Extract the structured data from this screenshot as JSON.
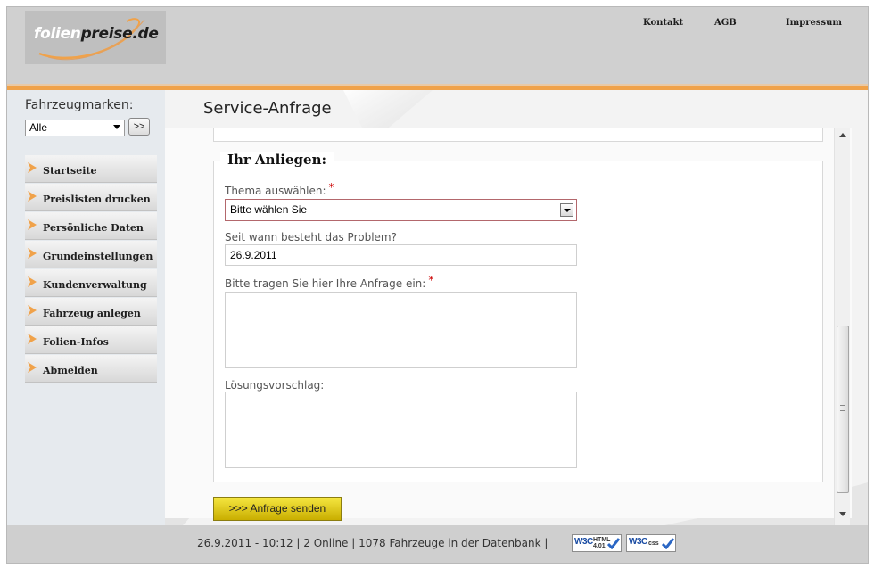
{
  "header": {
    "logo": {
      "part1": "folien",
      "part2": "preise.de"
    },
    "nav": [
      "Kontakt",
      "AGB",
      "Impressum"
    ]
  },
  "sidebar": {
    "brand_label": "Fahrzeugmarken:",
    "brand_select_value": "Alle",
    "go_button": ">>",
    "menu": [
      "Startseite",
      "Preislisten drucken",
      "Persönliche Daten",
      "Grundeinstellungen",
      "Kundenverwaltung",
      "Fahrzeug anlegen",
      "Folien-Infos",
      "Abmelden"
    ]
  },
  "main": {
    "title": "Service-Anfrage",
    "legend": "Ihr Anliegen:",
    "required_marker": "*",
    "fields": {
      "topic_label": "Thema auswählen:",
      "topic_value": "Bitte wählen Sie",
      "since_label": "Seit wann besteht das Problem?",
      "since_value": "26.9.2011",
      "request_label": "Bitte tragen Sie hier Ihre Anfrage ein:",
      "request_value": "",
      "solution_label": "Lösungsvorschlag:",
      "solution_value": ""
    },
    "submit_button": ">>> Anfrage senden"
  },
  "footer": {
    "status_text": "26.9.2011 - 10:12 | 2 Online | 1078 Fahrzeuge in der Datenbank |",
    "badges": [
      {
        "logo": "W3C",
        "kind_line1": "HTML",
        "kind_line2": "4.01"
      },
      {
        "logo": "W3C",
        "kind_line1": "css",
        "kind_line2": ""
      }
    ]
  },
  "colors": {
    "header_bg": "#d0d0d0",
    "accent_stripe": "#f0a24a",
    "sidebar_bg": "#e6eaee",
    "submit_button": "#e5d21f",
    "required_marker": "#cc0000",
    "invalid_border": "#b3676c"
  }
}
